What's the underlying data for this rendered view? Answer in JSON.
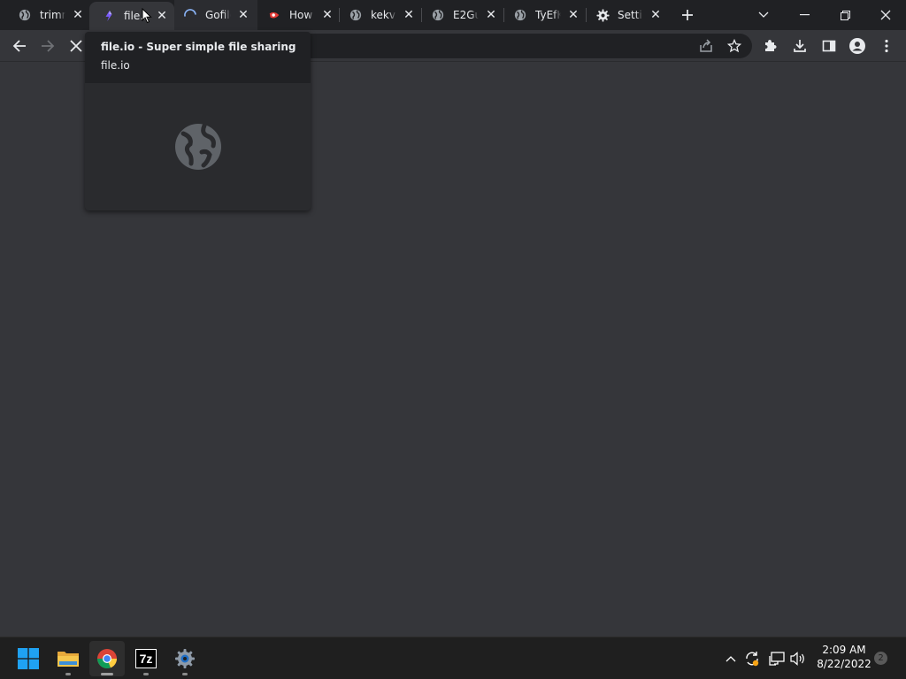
{
  "browser": {
    "tabs": [
      {
        "title": "trimm",
        "favicon": "globe-icon",
        "close": "✕"
      },
      {
        "title": "file.io",
        "favicon": "fileio-icon",
        "close": "✕"
      },
      {
        "title": "Gofile",
        "favicon": "loading-spinner-icon",
        "close": "✕"
      },
      {
        "title": "How",
        "favicon": "youtube-icon",
        "close": "✕"
      },
      {
        "title": "kekv",
        "favicon": "globe-icon",
        "close": "✕"
      },
      {
        "title": "E2Gu",
        "favicon": "globe-icon",
        "close": "✕"
      },
      {
        "title": "TyEfK",
        "favicon": "globe-icon",
        "close": "✕"
      },
      {
        "title": "Settir",
        "favicon": "settings-gear-icon",
        "close": "✕"
      }
    ],
    "hover_card": {
      "title": "file.io - Super simple file sharing",
      "domain": "file.io",
      "preview_icon": "globe-icon"
    },
    "colors": {
      "tabstrip": "#202124",
      "toolbar": "#35363a",
      "content": "#35363a",
      "card": "#202124"
    }
  },
  "taskbar": {
    "apps": [
      {
        "name": "start",
        "icon": "windows-logo-icon"
      },
      {
        "name": "file-explorer",
        "icon": "folder-icon"
      },
      {
        "name": "chrome",
        "icon": "chrome-icon"
      },
      {
        "name": "7zip",
        "icon": "7zip-icon",
        "label": "7z"
      },
      {
        "name": "settings",
        "icon": "settings-gear-icon"
      }
    ],
    "clock": {
      "time": "2:09 AM",
      "date": "8/22/2022"
    },
    "notifications": "2"
  }
}
